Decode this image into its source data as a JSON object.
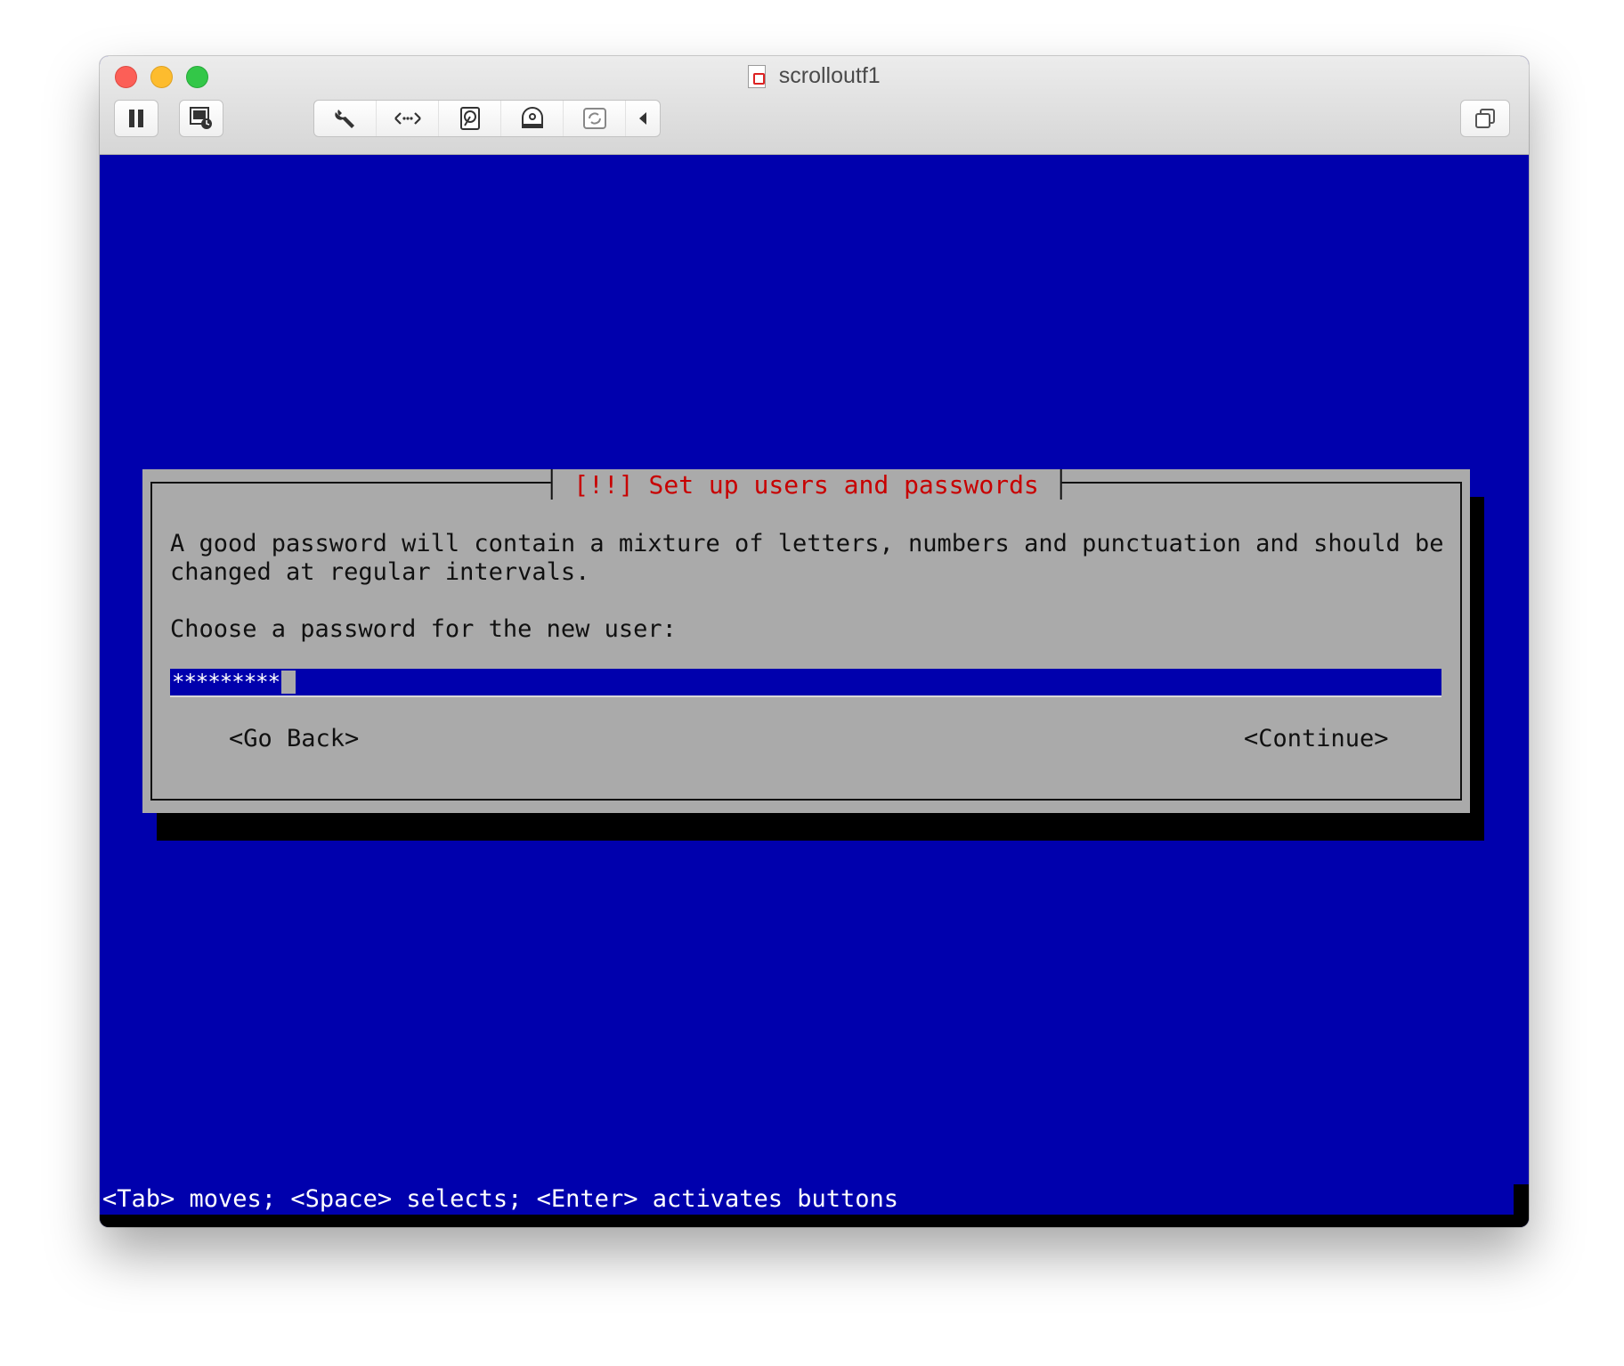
{
  "window": {
    "title": "scrolloutf1"
  },
  "toolbar": {
    "pause_icon": "pause-icon",
    "snapshot_icon": "snapshot-icon",
    "settings_icon": "wrench-icon",
    "network_icon": "network-arrows-icon",
    "hard_disk_icon": "hard-disk-icon",
    "optical_drive_icon": "optical-drive-icon",
    "usb_icon": "usb-icon",
    "collapse_icon": "chevron-left-icon",
    "restore_icon": "restore-window-icon"
  },
  "dialog": {
    "title": "[!!] Set up users and passwords",
    "description_line1": "A good password will contain a mixture of letters, numbers and punctuation and should be",
    "description_line2": "changed at regular intervals.",
    "prompt": "Choose a password for the new user:",
    "password_value": "*********",
    "go_back_label": "<Go Back>",
    "continue_label": "<Continue>"
  },
  "status_bar": {
    "text": "<Tab> moves; <Space> selects; <Enter> activates buttons"
  },
  "colors": {
    "console_bg": "#0000ad",
    "dialog_bg": "#aaaaaa",
    "title_text": "#c80000"
  }
}
